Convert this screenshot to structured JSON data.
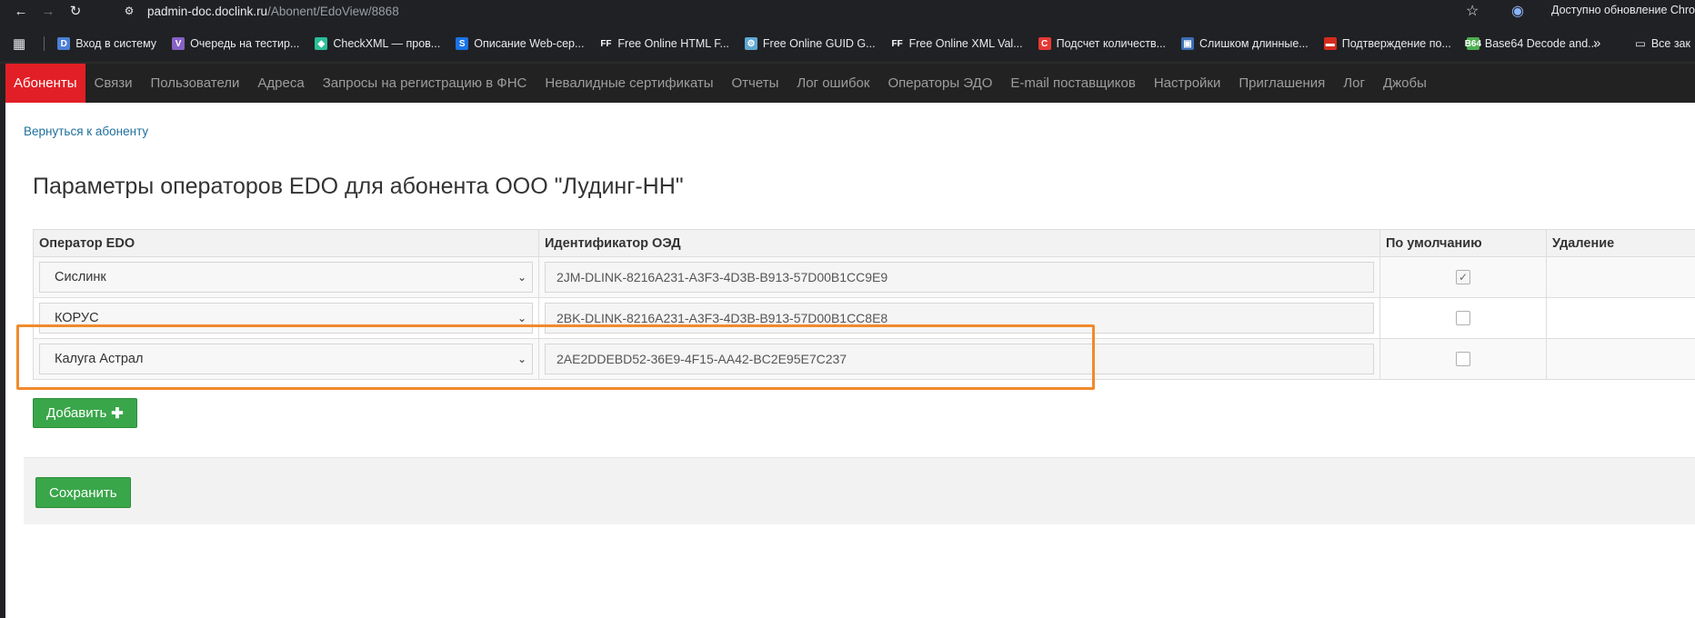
{
  "browser": {
    "url_host": "padmin-doc.doclink.ru",
    "url_path": "/Abonent/EdoView/8868",
    "update_notice": "Доступно обновление Chrom",
    "bookmarks": [
      {
        "label": "Вход в систему",
        "icon": "D",
        "color": "#4a7fd6"
      },
      {
        "label": "Очередь на тестир...",
        "icon": "V",
        "color": "#8661c5"
      },
      {
        "label": "CheckXML — пров...",
        "icon": "◆",
        "color": "#2bbf9a"
      },
      {
        "label": "Описание Web-сер...",
        "icon": "S",
        "color": "#1a73e8"
      },
      {
        "label": "Free Online HTML F...",
        "icon": "FF",
        "color": "#202124"
      },
      {
        "label": "Free Online GUID G...",
        "icon": "⚙",
        "color": "#5fa8d3"
      },
      {
        "label": "Free Online XML Val...",
        "icon": "FF",
        "color": "#202124"
      },
      {
        "label": "Подсчет количеств...",
        "icon": "C",
        "color": "#e53935"
      },
      {
        "label": "Слишком длинные...",
        "icon": "▣",
        "color": "#3b6fb6"
      },
      {
        "label": "Подтверждение по...",
        "icon": "▬",
        "color": "#d52b1e"
      },
      {
        "label": "Base64 Decode and...",
        "icon": "B64",
        "color": "#4caf50"
      }
    ],
    "other_bookmarks": "Все зак"
  },
  "nav": {
    "items": [
      "Абоненты",
      "Связи",
      "Пользователи",
      "Адреса",
      "Запросы на регистрацию в ФНС",
      "Невалидные сертификаты",
      "Отчеты",
      "Лог ошибок",
      "Операторы ЭДО",
      "E-mail поставщиков",
      "Настройки",
      "Приглашения",
      "Лог",
      "Джобы"
    ]
  },
  "page": {
    "back_link": "Вернуться к абоненту",
    "title": "Параметры операторов EDO для абонента ООО \"Лудинг-НН\"",
    "table": {
      "headers": [
        "Оператор EDO",
        "Идентификатор ОЭД",
        "По умолчанию",
        "Удаление"
      ],
      "rows": [
        {
          "operator": "Сислинк",
          "id": "2JM-DLINK-8216A231-A3F3-4D3B-B913-57D00B1CC9E9",
          "default": true
        },
        {
          "operator": "КОРУС",
          "id": "2BK-DLINK-8216A231-A3F3-4D3B-B913-57D00B1CC8E8",
          "default": false
        },
        {
          "operator": "Калуга Астрал",
          "id": "2AE2DDEBD52-36E9-4F15-AA42-BC2E95E7C237",
          "default": false
        }
      ]
    },
    "add_label": "Добавить",
    "save_label": "Сохранить"
  }
}
